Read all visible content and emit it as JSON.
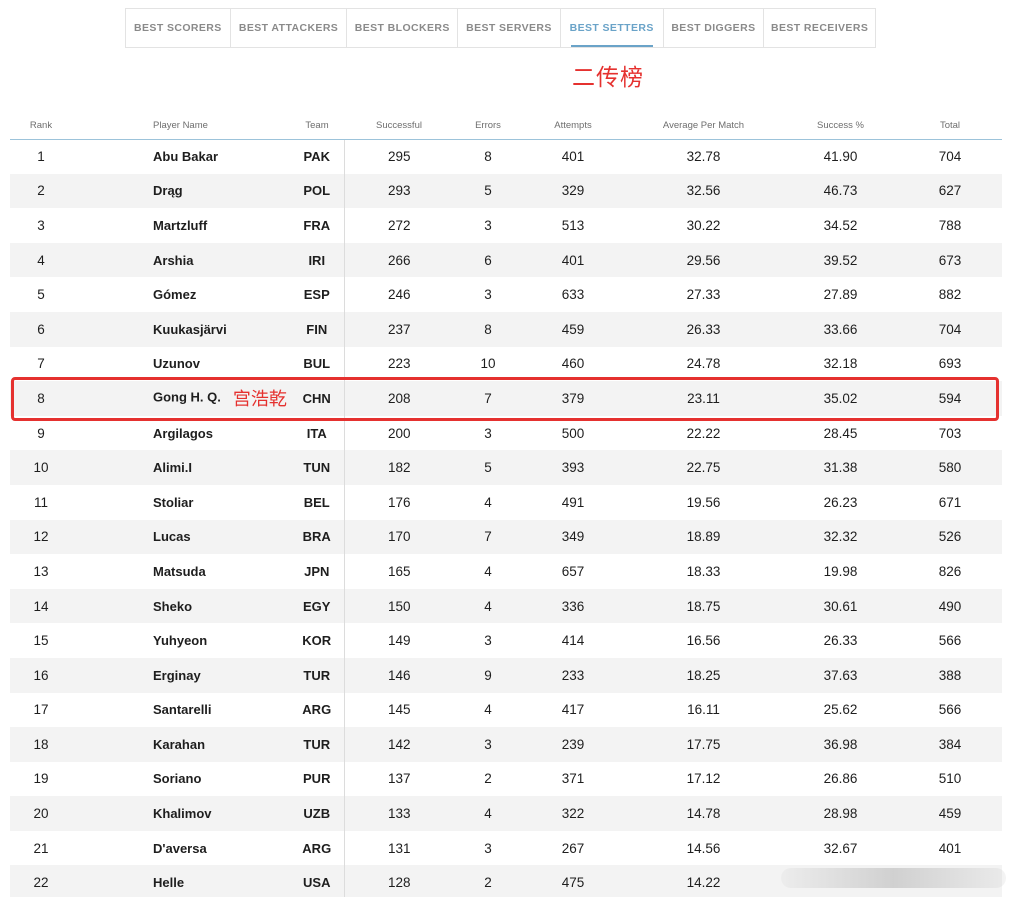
{
  "tabs": [
    {
      "label": "BEST SCORERS",
      "active": false
    },
    {
      "label": "BEST ATTACKERS",
      "active": false
    },
    {
      "label": "BEST BLOCKERS",
      "active": false
    },
    {
      "label": "BEST SERVERS",
      "active": false
    },
    {
      "label": "BEST SETTERS",
      "active": true
    },
    {
      "label": "BEST DIGGERS",
      "active": false
    },
    {
      "label": "BEST RECEIVERS",
      "active": false
    }
  ],
  "annotation": {
    "title": "二传榜",
    "highlight_name": "宫浩乾",
    "color": "#e5312f"
  },
  "columns": [
    "Rank",
    "Player Name",
    "Team",
    "Successful",
    "Errors",
    "Attempts",
    "Average Per Match",
    "Success %",
    "Total"
  ],
  "rows": [
    [
      "1",
      "Abu Bakar",
      "PAK",
      "295",
      "8",
      "401",
      "32.78",
      "41.90",
      "704"
    ],
    [
      "2",
      "Drąg",
      "POL",
      "293",
      "5",
      "329",
      "32.56",
      "46.73",
      "627"
    ],
    [
      "3",
      "Martzluff",
      "FRA",
      "272",
      "3",
      "513",
      "30.22",
      "34.52",
      "788"
    ],
    [
      "4",
      "Arshia",
      "IRI",
      "266",
      "6",
      "401",
      "29.56",
      "39.52",
      "673"
    ],
    [
      "5",
      "Gómez",
      "ESP",
      "246",
      "3",
      "633",
      "27.33",
      "27.89",
      "882"
    ],
    [
      "6",
      "Kuukasjärvi",
      "FIN",
      "237",
      "8",
      "459",
      "26.33",
      "33.66",
      "704"
    ],
    [
      "7",
      "Uzunov",
      "BUL",
      "223",
      "10",
      "460",
      "24.78",
      "32.18",
      "693"
    ],
    [
      "8",
      "Gong H. Q.",
      "CHN",
      "208",
      "7",
      "379",
      "23.11",
      "35.02",
      "594"
    ],
    [
      "9",
      "Argilagos",
      "ITA",
      "200",
      "3",
      "500",
      "22.22",
      "28.45",
      "703"
    ],
    [
      "10",
      "Alimi.I",
      "TUN",
      "182",
      "5",
      "393",
      "22.75",
      "31.38",
      "580"
    ],
    [
      "11",
      "Stoliar",
      "BEL",
      "176",
      "4",
      "491",
      "19.56",
      "26.23",
      "671"
    ],
    [
      "12",
      "Lucas",
      "BRA",
      "170",
      "7",
      "349",
      "18.89",
      "32.32",
      "526"
    ],
    [
      "13",
      "Matsuda",
      "JPN",
      "165",
      "4",
      "657",
      "18.33",
      "19.98",
      "826"
    ],
    [
      "14",
      "Sheko",
      "EGY",
      "150",
      "4",
      "336",
      "18.75",
      "30.61",
      "490"
    ],
    [
      "15",
      "Yuhyeon",
      "KOR",
      "149",
      "3",
      "414",
      "16.56",
      "26.33",
      "566"
    ],
    [
      "16",
      "Erginay",
      "TUR",
      "146",
      "9",
      "233",
      "18.25",
      "37.63",
      "388"
    ],
    [
      "17",
      "Santarelli",
      "ARG",
      "145",
      "4",
      "417",
      "16.11",
      "25.62",
      "566"
    ],
    [
      "18",
      "Karahan",
      "TUR",
      "142",
      "3",
      "239",
      "17.75",
      "36.98",
      "384"
    ],
    [
      "19",
      "Soriano",
      "PUR",
      "137",
      "2",
      "371",
      "17.12",
      "26.86",
      "510"
    ],
    [
      "20",
      "Khalimov",
      "UZB",
      "133",
      "4",
      "322",
      "14.78",
      "28.98",
      "459"
    ],
    [
      "21",
      "D'aversa",
      "ARG",
      "131",
      "3",
      "267",
      "14.56",
      "32.67",
      "401"
    ],
    [
      "22",
      "Helle",
      "USA",
      "128",
      "2",
      "475",
      "14.22",
      "",
      ""
    ]
  ]
}
